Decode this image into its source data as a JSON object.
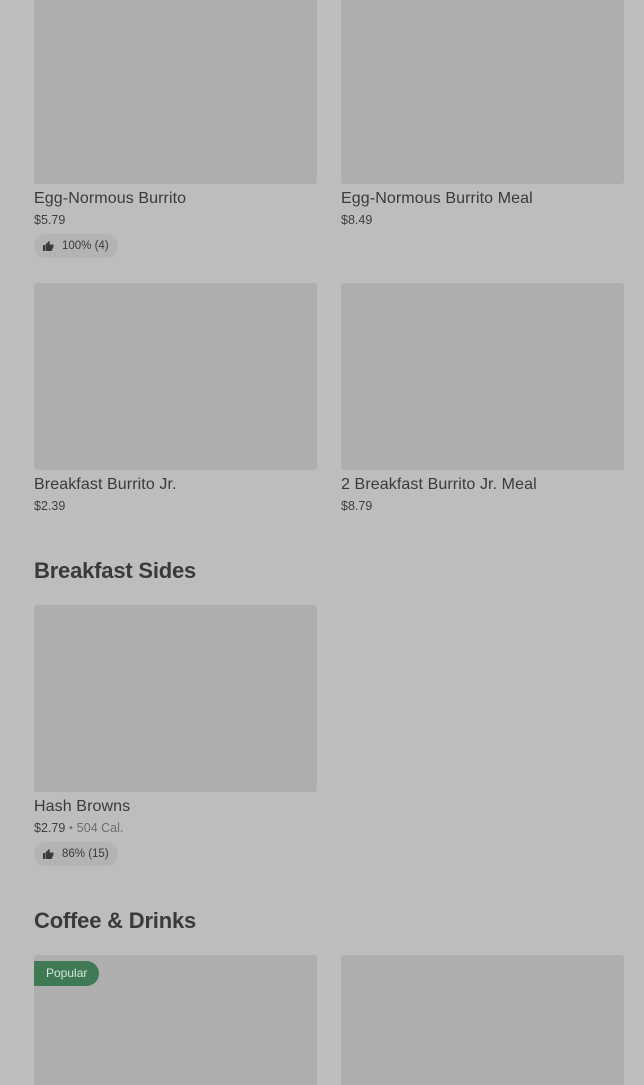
{
  "sections": {
    "burritos": {
      "items": [
        {
          "name": "Egg-Normous Burrito",
          "price": "$5.79",
          "rating": "100% (4)"
        },
        {
          "name": "Egg-Normous Burrito Meal",
          "price": "$8.49"
        },
        {
          "name": "Breakfast Burrito Jr.",
          "price": "$2.39"
        },
        {
          "name": "2 Breakfast Burrito Jr. Meal",
          "price": "$8.79"
        }
      ]
    },
    "breakfast_sides": {
      "title": "Breakfast Sides",
      "items": [
        {
          "name": "Hash Browns",
          "price": "$2.79",
          "separator": "•",
          "calories": "504 Cal.",
          "rating": "86% (15)"
        }
      ]
    },
    "coffee_drinks": {
      "title": "Coffee & Drinks",
      "items": [
        {
          "badge": "Popular"
        },
        {}
      ]
    }
  },
  "colors": {
    "background": "#bdbdbd",
    "image_placeholder": "#aeaeae",
    "popular_badge": "#3f7a55"
  },
  "icons": {
    "rating": "thumbs-up-icon"
  }
}
